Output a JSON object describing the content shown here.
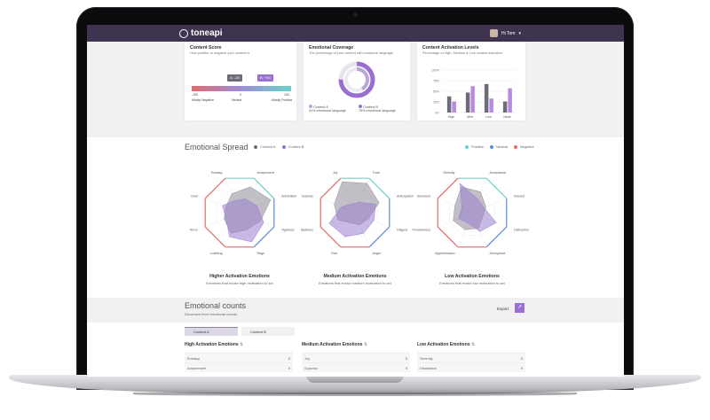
{
  "app": {
    "brand": "toneapi",
    "user": "Hi Tom"
  },
  "cards": [
    {
      "title": "Content Score",
      "subtitle": "How positive or negative your content is",
      "scale": {
        "min": "-100",
        "mid": "0",
        "max": "100",
        "tip_a": "A: -28",
        "tip_b": "B: +54",
        "left_label": "Mostly Negative",
        "mid_label": "Neutral",
        "right_label": "Mostly Positive"
      }
    },
    {
      "title": "Emotional Coverage",
      "subtitle": "The percentage of your content with emotional language",
      "legend": [
        {
          "name": "Content A",
          "value": "41% emotional language"
        },
        {
          "name": "Content B",
          "value": "75% emotional language"
        }
      ]
    },
    {
      "title": "Content Activation Levels",
      "subtitle": "Percentage of High, Medium & Low content activation",
      "yticks": [
        "100%",
        "75%",
        "50%",
        "25%",
        "0%"
      ],
      "categories": [
        "High",
        "Med",
        "Low",
        "None"
      ]
    }
  ],
  "spread": {
    "title": "Emotional Spread",
    "legend": [
      "Content A",
      "Content B"
    ],
    "tone_legend": [
      "Positive",
      "Neutral",
      "Negative"
    ],
    "radars": [
      {
        "labels": [
          "Ecstasy",
          "Amazement",
          "Admiration",
          "Vigilance",
          "Rage",
          "Loathing",
          "Terror",
          "Grief"
        ],
        "title": "Higher Activation Emotions",
        "subtitle": "Emotions that evoke high motivation to act"
      },
      {
        "labels": [
          "Joy",
          "Trust",
          "Anticipation",
          "Disgust",
          "Anger",
          "Fear",
          "Sadness",
          "Surprise"
        ],
        "title": "Medium Activation Emotions",
        "subtitle": "Emotions that evoke medium motivation to act"
      },
      {
        "labels": [
          "Serenity",
          "Acceptance",
          "Interest",
          "Distraction",
          "Annoyance",
          "Apprehension",
          "Pensiveness",
          "Boredom"
        ],
        "title": "Low Activation Emotions",
        "subtitle": "Emotions that evoke low motivation to act"
      }
    ]
  },
  "counts": {
    "title": "Emotional counts",
    "subtitle": "Document level emotional counts",
    "export": "Export",
    "tabs": [
      "Content A",
      "Content B"
    ],
    "columns": [
      {
        "title": "High Activation Emotions",
        "rows": [
          {
            "name": "Ecstasy",
            "count": "5"
          },
          {
            "name": "Amazement",
            "count": "9"
          }
        ]
      },
      {
        "title": "Medium Activation Emotions",
        "rows": [
          {
            "name": "Joy",
            "count": "5"
          },
          {
            "name": "Surprise",
            "count": "9"
          }
        ]
      },
      {
        "title": "Low Activation Emotions",
        "rows": [
          {
            "name": "Serenity",
            "count": "5"
          },
          {
            "name": "Distraction",
            "count": "9"
          }
        ]
      }
    ]
  },
  "chart_data": {
    "type": "bar",
    "categories": [
      "High",
      "Med",
      "Low",
      "None"
    ],
    "series": [
      {
        "name": "Content A",
        "values": [
          38,
          47,
          67,
          26
        ]
      },
      {
        "name": "Content B",
        "values": [
          26,
          62,
          33,
          57
        ]
      }
    ],
    "ylim": [
      0,
      100
    ]
  }
}
